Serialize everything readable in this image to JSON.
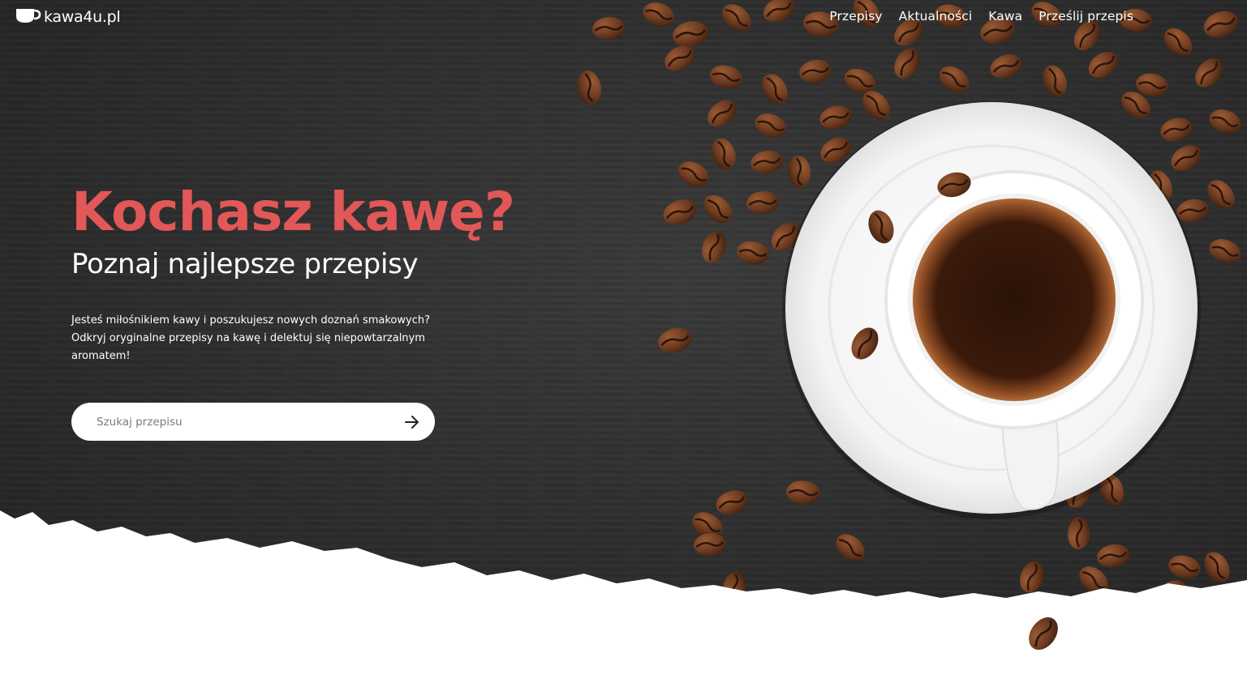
{
  "brand": {
    "name": "kawa4u.pl",
    "icon": "coffee-cup-icon"
  },
  "nav": {
    "items": [
      {
        "label": "Przepisy"
      },
      {
        "label": "Aktualności"
      },
      {
        "label": "Kawa"
      },
      {
        "label": "Prześlij przepis"
      }
    ]
  },
  "hero": {
    "headline": "Kochasz kawę?",
    "subheadline": "Poznaj najlepsze przepisy",
    "intro": "Jesteś miłośnikiem kawy i poszukujesz nowych doznań smakowych? Odkryj oryginalne przepisy na kawę i delektuj się niepowtarzalnym aromatem!"
  },
  "search": {
    "placeholder": "Szukaj przepisu",
    "submit_icon": "arrow-right-icon"
  },
  "colors": {
    "accent": "#e25757",
    "background_dark": "#2c2c2c",
    "text_light": "#ffffff"
  }
}
